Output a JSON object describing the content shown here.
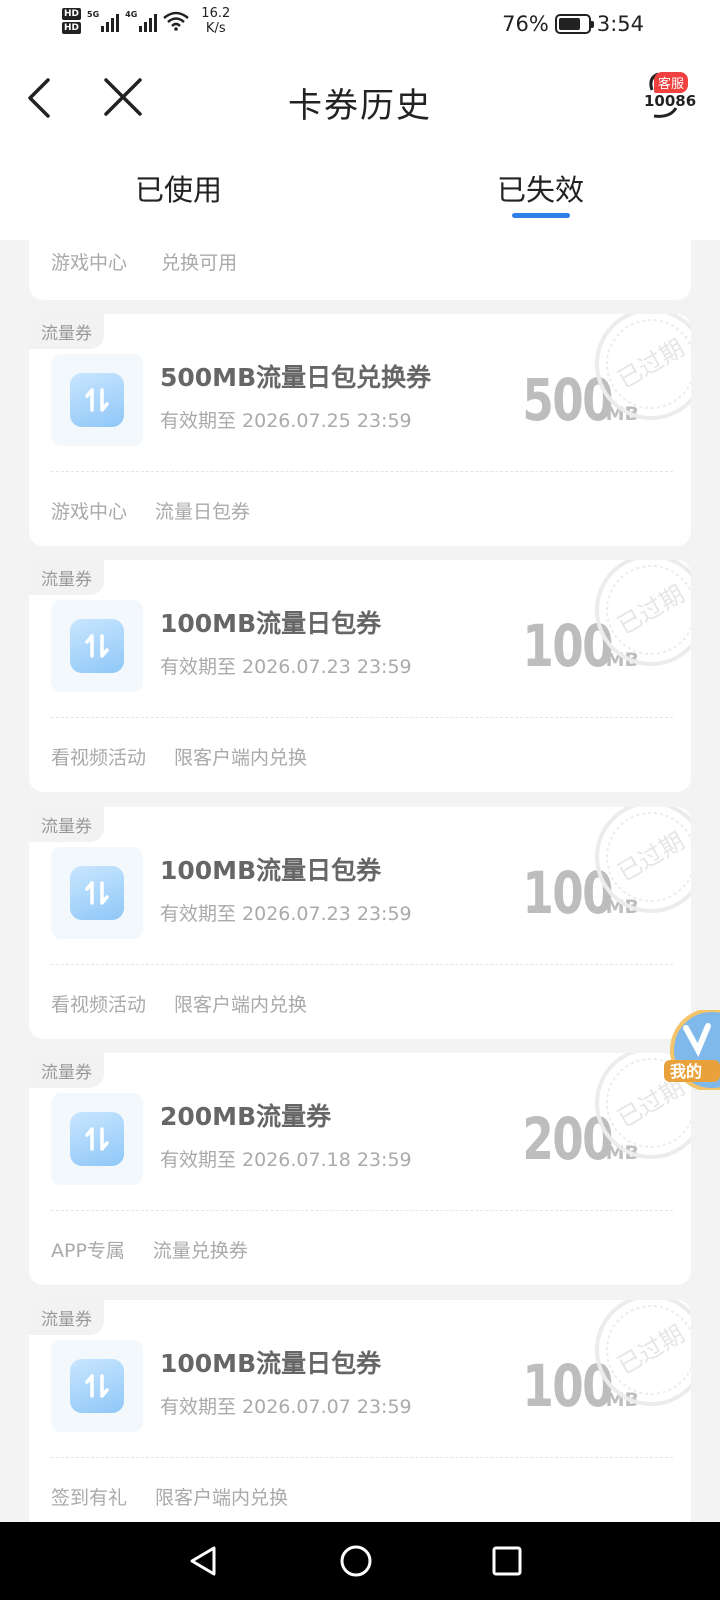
{
  "status_bar": {
    "hd1": "HD",
    "hd2": "HD",
    "net1": "5G",
    "net2": "4G",
    "speed_value": "16.2",
    "speed_unit": "K/s",
    "battery": "76%",
    "time": "3:54"
  },
  "header": {
    "title": "卡券历史",
    "service_badge": "客服",
    "service_number": "10086"
  },
  "tabs": [
    {
      "label": "已使用"
    },
    {
      "label": "已失效"
    }
  ],
  "partial_card": {
    "tags": [
      "游戏中心",
      "兑换可用"
    ]
  },
  "coupons": [
    {
      "label": "流量券",
      "name": "500MB流量日包兑换券",
      "date": "有效期至 2026.07.25 23:59",
      "amount": "500",
      "unit": "MB",
      "stamp": "已过期",
      "tags": [
        "游戏中心",
        "流量日包券"
      ]
    },
    {
      "label": "流量券",
      "name": "100MB流量日包券",
      "date": "有效期至 2026.07.23 23:59",
      "amount": "100",
      "unit": "MB",
      "stamp": "已过期",
      "tags": [
        "看视频活动",
        "限客户端内兑换"
      ]
    },
    {
      "label": "流量券",
      "name": "100MB流量日包券",
      "date": "有效期至 2026.07.23 23:59",
      "amount": "100",
      "unit": "MB",
      "stamp": "已过期",
      "tags": [
        "看视频活动",
        "限客户端内兑换"
      ]
    },
    {
      "label": "流量券",
      "name": "200MB流量券",
      "date": "有效期至 2026.07.18 23:59",
      "amount": "200",
      "unit": "MB",
      "stamp": "已过期",
      "tags": [
        "APP专属",
        "流量兑换券"
      ]
    },
    {
      "label": "流量券",
      "name": "100MB流量日包券",
      "date": "有效期至 2026.07.07 23:59",
      "amount": "100",
      "unit": "MB",
      "stamp": "已过期",
      "tags": [
        "签到有礼",
        "限客户端内兑换"
      ]
    }
  ],
  "float_widget": {
    "label": "我的"
  },
  "colors": {
    "accent": "#2e7fe8",
    "badge": "#f04040"
  }
}
